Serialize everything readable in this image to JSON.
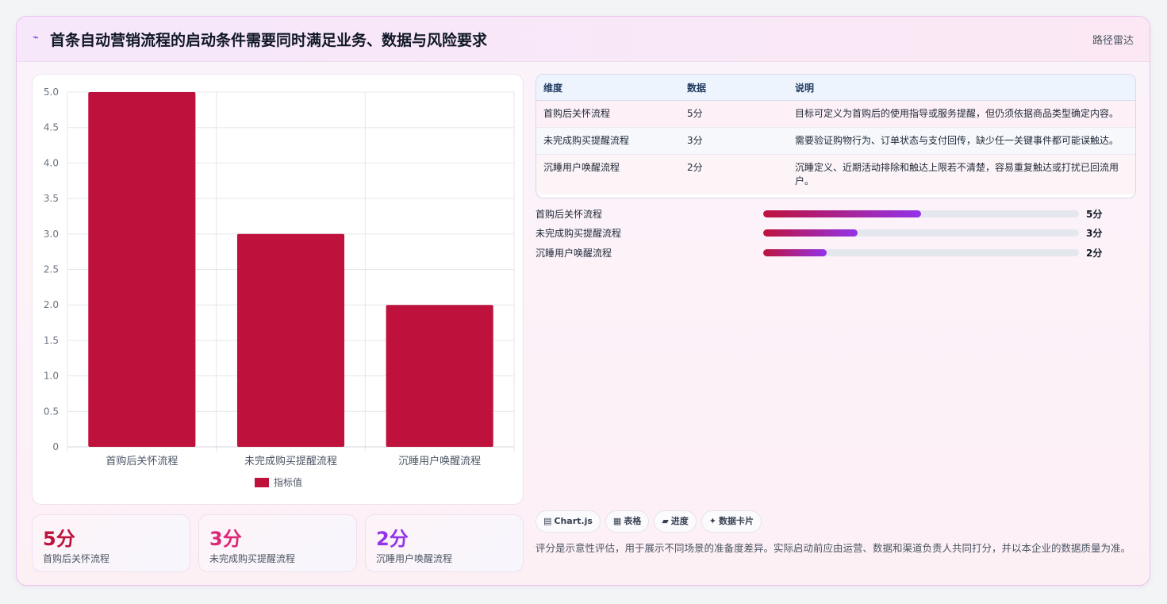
{
  "header": {
    "icon": "route-icon",
    "title": "首条自动营销流程的启动条件需要同时满足业务、数据与风险要求",
    "link": "路径雷达"
  },
  "chart_data": {
    "type": "bar",
    "categories": [
      "首购后关怀流程",
      "未完成购买提醒流程",
      "沉睡用户唤醒流程"
    ],
    "series": [
      {
        "name": "指标值",
        "values": [
          5,
          3,
          2
        ]
      }
    ],
    "ylim": [
      0,
      5
    ],
    "yticks": [
      "5.0",
      "4.5",
      "4.0",
      "3.5",
      "3.0",
      "2.5",
      "2.0",
      "1.5",
      "1.0",
      "0.5",
      "0"
    ],
    "grid": true,
    "legend": "bottom",
    "bar_color": "#be123c"
  },
  "stats": [
    {
      "value": "5分",
      "label": "首购后关怀流程",
      "color": "#be123c"
    },
    {
      "value": "3分",
      "label": "未完成购买提醒流程",
      "color": "#db2777"
    },
    {
      "value": "2分",
      "label": "沉睡用户唤醒流程",
      "color": "#9333ea"
    }
  ],
  "table": {
    "headers": [
      "维度",
      "数据",
      "说明"
    ],
    "rows": [
      [
        "首购后关怀流程",
        "5分",
        "目标可定义为首购后的使用指导或服务提醒，但仍须依据商品类型确定内容。"
      ],
      [
        "未完成购买提醒流程",
        "3分",
        "需要验证购物行为、订单状态与支付回传，缺少任一关键事件都可能误触达。"
      ],
      [
        "沉睡用户唤醒流程",
        "2分",
        "沉睡定义、近期活动排除和触达上限若不清楚，容易重复触达或打扰已回流用户。"
      ]
    ]
  },
  "progress": [
    {
      "label": "首购后关怀流程",
      "value": 5,
      "max": 10,
      "value_label": "5分"
    },
    {
      "label": "未完成购买提醒流程",
      "value": 3,
      "max": 10,
      "value_label": "3分"
    },
    {
      "label": "沉睡用户唤醒流程",
      "value": 2,
      "max": 10,
      "value_label": "2分"
    }
  ],
  "chips": [
    {
      "icon": "chart-icon",
      "glyph": "▤",
      "label": "Chart.js"
    },
    {
      "icon": "table-icon",
      "glyph": "▦",
      "label": "表格"
    },
    {
      "icon": "progress-icon",
      "glyph": "▰",
      "label": "进度"
    },
    {
      "icon": "card-icon",
      "glyph": "✦",
      "label": "数据卡片"
    }
  ],
  "note": "评分是示意性评估，用于展示不同场景的准备度差异。实际启动前应由运营、数据和渠道负责人共同打分，并以本企业的数据质量为准。"
}
